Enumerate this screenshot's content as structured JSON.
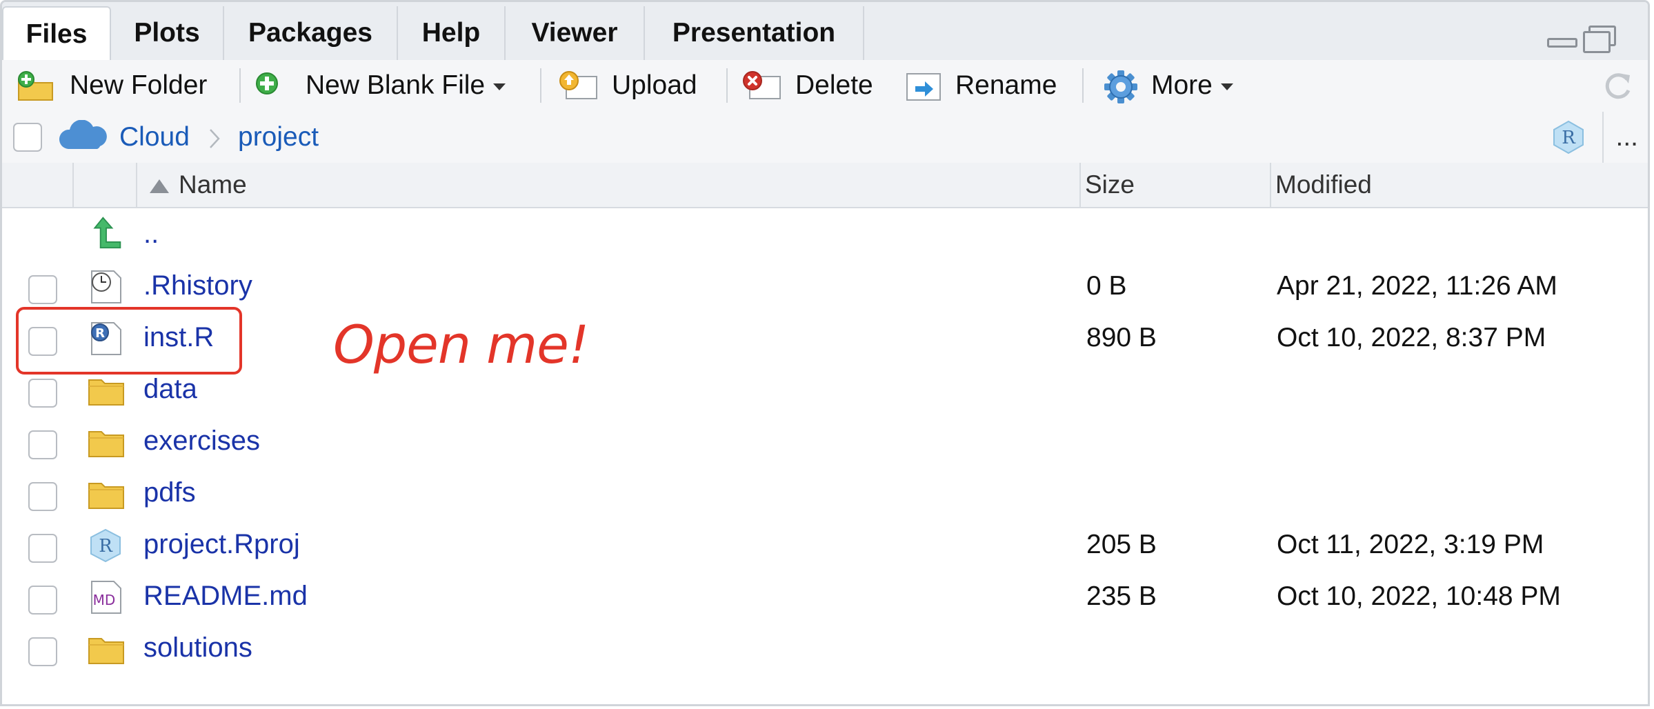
{
  "tabs": [
    "Files",
    "Plots",
    "Packages",
    "Help",
    "Viewer",
    "Presentation"
  ],
  "toolbar": {
    "new_folder": "New Folder",
    "new_blank_file": "New Blank File",
    "upload": "Upload",
    "delete": "Delete",
    "rename": "Rename",
    "more": "More"
  },
  "path": {
    "root": "Cloud",
    "current": "project",
    "more": "..."
  },
  "columns": {
    "name": "Name",
    "size": "Size",
    "modified": "Modified"
  },
  "parent_dir": "..",
  "files": [
    {
      "name": ".Rhistory",
      "size": "0 B",
      "modified": "Apr 21, 2022, 11:26 AM",
      "icon": "history-file-icon"
    },
    {
      "name": "inst.R",
      "size": "890 B",
      "modified": "Oct 10, 2022, 8:37 PM",
      "icon": "r-script-icon"
    },
    {
      "name": "data",
      "size": "",
      "modified": "",
      "icon": "folder-icon"
    },
    {
      "name": "exercises",
      "size": "",
      "modified": "",
      "icon": "folder-icon"
    },
    {
      "name": "pdfs",
      "size": "",
      "modified": "",
      "icon": "folder-icon"
    },
    {
      "name": "project.Rproj",
      "size": "205 B",
      "modified": "Oct 11, 2022, 3:19 PM",
      "icon": "rproj-icon"
    },
    {
      "name": "README.md",
      "size": "235 B",
      "modified": "Oct 10, 2022, 10:48 PM",
      "icon": "markdown-file-icon"
    },
    {
      "name": "solutions",
      "size": "",
      "modified": "",
      "icon": "folder-icon"
    }
  ],
  "annotation": "Open me!",
  "colors": {
    "link": "#1a33a8",
    "annotation": "#e33529",
    "folder": "#f2c94c"
  }
}
